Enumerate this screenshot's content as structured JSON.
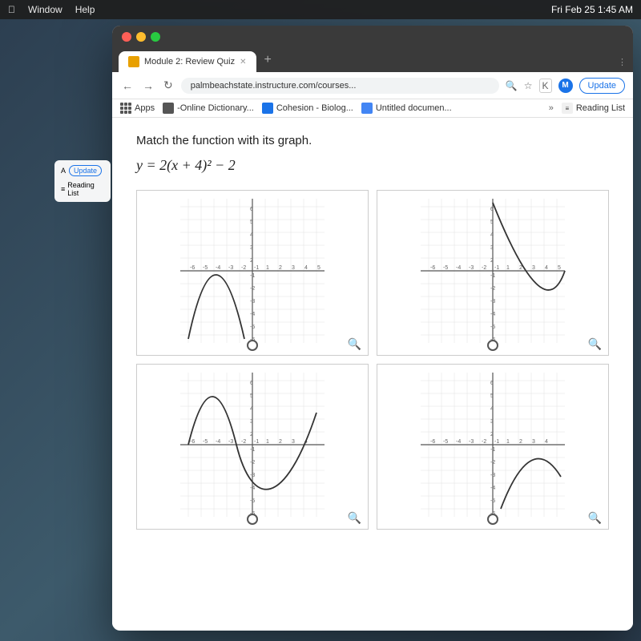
{
  "menubar": {
    "items": [
      "Window",
      "Help"
    ],
    "datetime": "Fri Feb 25  1:45 AM"
  },
  "browser": {
    "tab": {
      "label": "Module 2: Review Quiz",
      "favicon_color": "#e8a000"
    },
    "address": "palmbeachstate.instructure.com/courses...",
    "update_btn": "Update",
    "bookmarks": [
      {
        "label": "Apps",
        "type": "apps"
      },
      {
        "label": "-Online Dictionary...",
        "type": "favicon",
        "color": "#555"
      },
      {
        "label": "Cohesion - Biolog...",
        "type": "favicon",
        "color": "#1a73e8"
      },
      {
        "label": "Untitled documen...",
        "type": "favicon",
        "color": "#4285f4"
      }
    ],
    "reading_list": "Reading List"
  },
  "page": {
    "question": "Match the function with its graph.",
    "formula": "y = 2(x + 4)² − 2",
    "graphs": [
      {
        "id": "A",
        "type": "parabola_up_left"
      },
      {
        "id": "B",
        "type": "parabola_up_right"
      },
      {
        "id": "C",
        "type": "wave"
      },
      {
        "id": "D",
        "type": "parabola_up_right_small"
      }
    ]
  },
  "sidebar": {
    "update_btn": "Update",
    "reading_list": "Reading List"
  }
}
